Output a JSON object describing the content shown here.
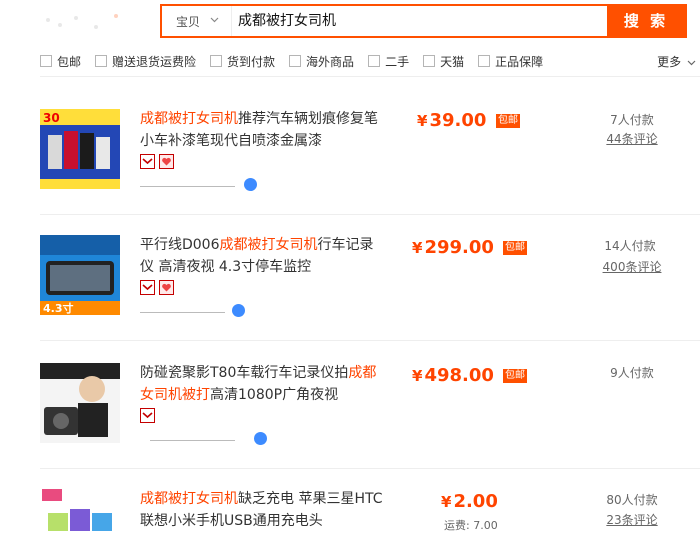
{
  "search": {
    "category": "宝贝",
    "query": "成都被打女司机",
    "button": "搜 索"
  },
  "filters": [
    {
      "label": "包邮"
    },
    {
      "label": "赠送退货运费险"
    },
    {
      "label": "货到付款"
    },
    {
      "label": "海外商品"
    },
    {
      "label": "二手"
    },
    {
      "label": "天猫"
    },
    {
      "label": "正品保障"
    }
  ],
  "more_label": "更多",
  "items": [
    {
      "title_hl": "成都被打女司机",
      "title_rest": "推荐汽车辆划痕修复笔小车补漆笔现代自喷漆金属漆",
      "price": "39.00",
      "currency": "¥",
      "baoyou": "包邮",
      "payers": "7人付款",
      "comments": "44条评论"
    },
    {
      "title_pre": "平行线D006",
      "title_hl": "成都被打女司机",
      "title_rest": "行车记录仪 高清夜视 4.3寸停车监控",
      "price": "299.00",
      "currency": "¥",
      "baoyou": "包邮",
      "payers": "14人付款",
      "comments": "400条评论",
      "thumb_text": "4.3寸"
    },
    {
      "title_pre": "防碰瓷聚影T80车载行车记录仪拍",
      "title_hl": "成都女司机被打",
      "title_rest": "高清1080P广角夜视",
      "price": "498.00",
      "currency": "¥",
      "baoyou": "包邮",
      "payers": "9人付款"
    },
    {
      "title_hl": "成都被打女司机",
      "title_rest": "缺乏充电 苹果三星HTC联想小米手机USB通用充电头",
      "price": "2.00",
      "currency": "¥",
      "shipping": "运费: 7.00",
      "payers": "80人付款",
      "comments": "23条评论"
    }
  ],
  "colors": {
    "accent": "#ff5000",
    "highlight": "#ff4400"
  }
}
